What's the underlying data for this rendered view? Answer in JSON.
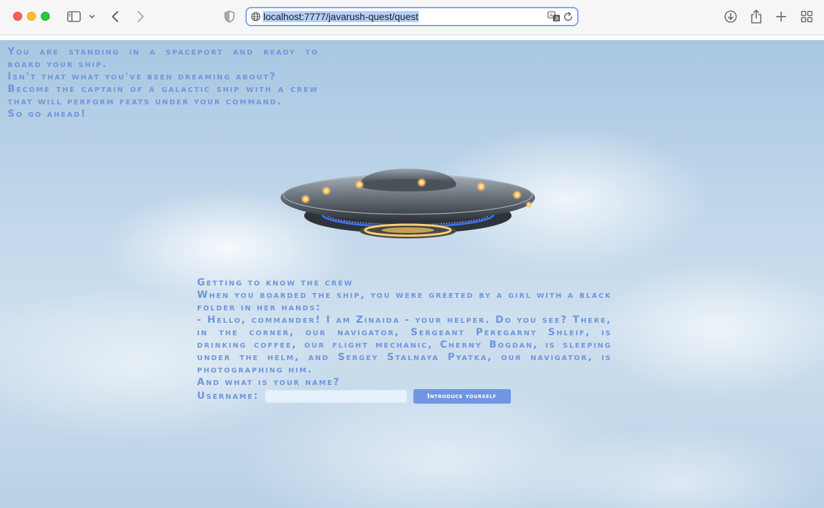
{
  "browser": {
    "url": "localhost:7777/javarush-quest/quest"
  },
  "intro_paragraphs": [
    "You are standing in a spaceport and ready to board your ship.",
    "Isn't that what you've been dreaming about?",
    "Become the captain of a galactic ship with a crew that will perform feats under your command.",
    "So go ahead!"
  ],
  "crew_section": {
    "paragraphs": [
      "Getting to know the crew",
      "When you boarded the ship, you were greeted by a girl with a black folder in her hands:",
      "- Hello, commander! I am Zinaida - your helper. Do you see? There, in the corner, our navigator, Sergeant Peregarny Shleif, is drinking coffee, our flight mechanic, Cherny Bogdan, is sleeping under the helm, and Sergey Stalnaya Pyatka, our navigator, is photographing him.",
      "And what is your name?"
    ],
    "username_label": "Username:",
    "username_value": "",
    "submit_label": "Introduce yourself"
  },
  "colors": {
    "text": "#6f96dc",
    "button": "#6f96e0"
  },
  "icons": {
    "sidebar": "sidebar-icon",
    "back": "chevron-left-icon",
    "forward": "chevron-right-icon",
    "privacy": "shield-icon",
    "site": "globe-icon",
    "translate": "translate-icon",
    "reload": "reload-icon",
    "downloads": "download-icon",
    "share": "share-icon",
    "new_tab": "plus-icon",
    "tab_overview": "tab-grid-icon"
  }
}
